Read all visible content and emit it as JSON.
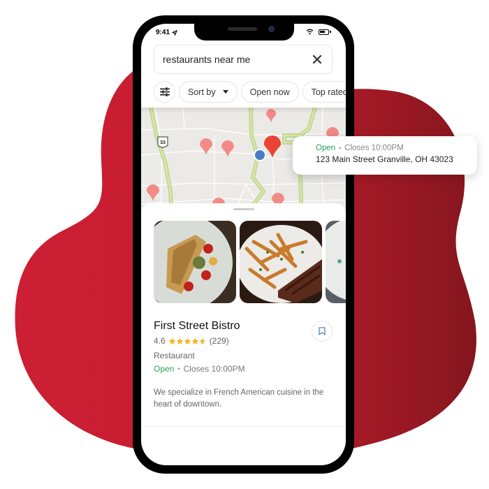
{
  "colors": {
    "blob_left": "#cc1f33",
    "blob_right": "#8a161f",
    "open_green": "#2aa05a",
    "pin_active": "#ea4335",
    "pin_inactive": "#f28b87",
    "user_location": "#4a7bc4",
    "star": "#f5b324"
  },
  "status_bar": {
    "time": "9:41",
    "location_icon": "location-arrow-icon",
    "wifi_icon": "wifi-icon",
    "battery_icon": "battery-icon"
  },
  "search": {
    "value": "restaurants near me",
    "clear_icon": "close-icon"
  },
  "filters": {
    "settings_icon": "sliders-icon",
    "chips": [
      {
        "label": "Sort by",
        "has_dropdown": true
      },
      {
        "label": "Open now",
        "has_dropdown": false
      },
      {
        "label": "Top rated",
        "has_dropdown": false
      }
    ]
  },
  "map": {
    "highway_shield": "33"
  },
  "info_card": {
    "status": "Open",
    "separator": "•",
    "closes": "Closes 10:00PM",
    "address": "123 Main Street Granville, OH 43023"
  },
  "place": {
    "name": "First Street Bistro",
    "rating": "4.6",
    "rating_value": 4.6,
    "rating_max": 5,
    "review_count": "(229)",
    "category": "Restaurant",
    "status": "Open",
    "separator": "•",
    "closes": "Closes 10:00PM",
    "description": "We specialize in French American cuisine in the heart of downtown.",
    "photos": [
      "fish-dish-photo",
      "steak-frites-photo",
      "plated-dish-photo"
    ],
    "bookmark_icon": "bookmark-icon"
  }
}
